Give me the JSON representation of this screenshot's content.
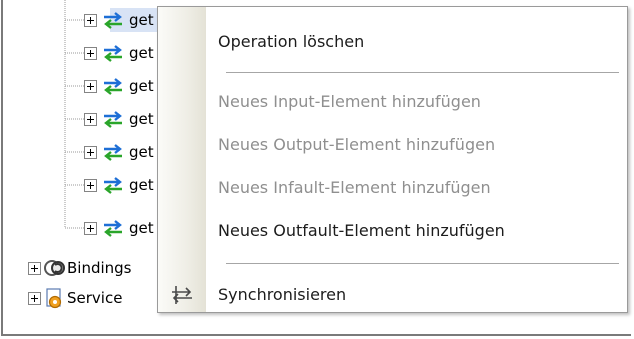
{
  "tree": {
    "operation_nodes": [
      {
        "label": "get"
      },
      {
        "label": "get"
      },
      {
        "label": "get"
      },
      {
        "label": "get"
      },
      {
        "label": "get"
      },
      {
        "label": "get"
      },
      {
        "label": "get"
      }
    ],
    "bindings_label": "Bindings",
    "service_label": "Service"
  },
  "context_menu": {
    "items": [
      {
        "label": "Operation löschen",
        "enabled": true
      },
      {
        "label": "Neues Input-Element hinzufügen",
        "enabled": false
      },
      {
        "label": "Neues Output-Element hinzufügen",
        "enabled": false
      },
      {
        "label": "Neues Infault-Element hinzufügen",
        "enabled": false
      },
      {
        "label": "Neues Outfault-Element hinzufügen",
        "enabled": true
      },
      {
        "label": "Synchronisieren",
        "enabled": true,
        "icon": "synchronize-icon"
      }
    ]
  },
  "colors": {
    "selection_bg": "#d8e3f5",
    "operation_icon_blue": "#1e6fd6",
    "operation_icon_green": "#2aa52a",
    "disabled_text": "#8f8f8f"
  }
}
